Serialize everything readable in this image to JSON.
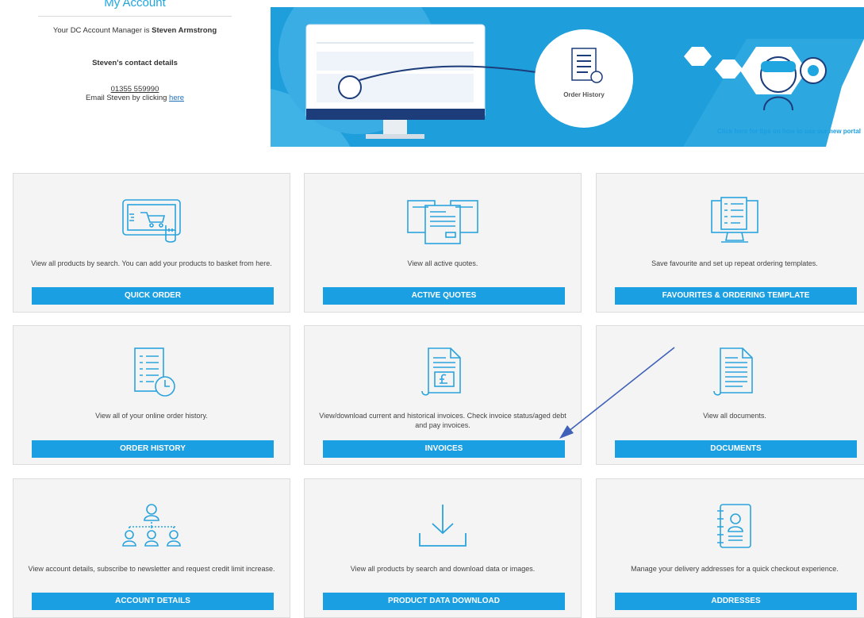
{
  "account": {
    "title": "My Account",
    "manager_prefix": "Your DC Account Manager is ",
    "manager_name": "Steven Armstrong",
    "contact_heading": "Steven's contact details",
    "phone": "01355 559990",
    "email_prefix": "Email Steven by clicking ",
    "email_link": "here"
  },
  "banner": {
    "order_history": "Order History",
    "tips_link": "Click here for tips on how to use our new portal"
  },
  "tiles": [
    {
      "icon": "basket-tablet-icon",
      "desc": "View all products by search. You can add your products to basket from here.",
      "button": "QUICK ORDER"
    },
    {
      "icon": "quotes-icon",
      "desc": "View all active quotes.",
      "button": "ACTIVE QUOTES"
    },
    {
      "icon": "favourites-template-icon",
      "desc": "Save favourite and set up repeat ordering templates.",
      "button": "FAVOURITES & ORDERING TEMPLATE"
    },
    {
      "icon": "order-history-icon",
      "desc": "View all of your online order history.",
      "button": "ORDER HISTORY"
    },
    {
      "icon": "invoice-pound-icon",
      "desc": "View/download current and historical invoices. Check invoice status/aged debt and pay invoices.",
      "button": "INVOICES"
    },
    {
      "icon": "document-icon",
      "desc": "View all documents.",
      "button": "DOCUMENTS"
    },
    {
      "icon": "account-hierarchy-icon",
      "desc": "View account details, subscribe to newsletter and request credit limit increase.",
      "button": "ACCOUNT DETAILS"
    },
    {
      "icon": "download-icon",
      "desc": "View all products by search and download data or images.",
      "button": "PRODUCT DATA DOWNLOAD"
    },
    {
      "icon": "address-book-icon",
      "desc": "Manage your delivery addresses for a quick checkout experience.",
      "button": "ADDRESSES"
    }
  ],
  "colors": {
    "accent": "#1a9fe2",
    "banner": "#1e9fdc",
    "tile_bg": "#f4f4f4",
    "annotation_arrow": "#3f62b8"
  }
}
